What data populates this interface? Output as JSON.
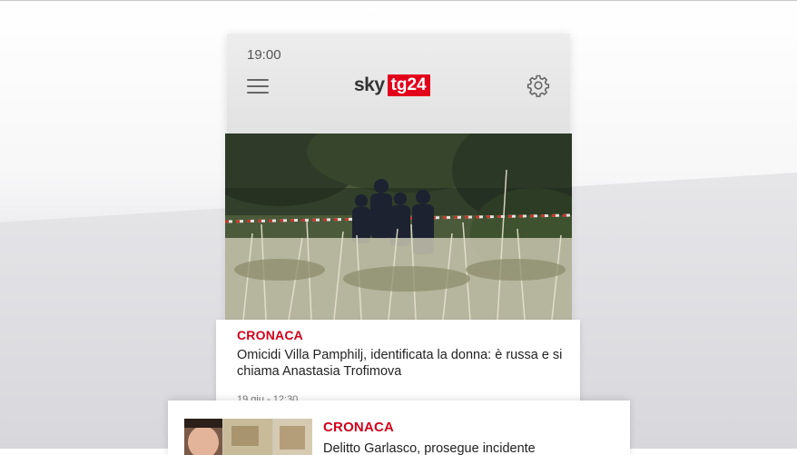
{
  "status_bar": {
    "time": "19:00"
  },
  "header": {
    "logo_sky": "sky",
    "logo_tg": "tg24",
    "brand_color": "#e2001a",
    "menu_icon": "hamburger-menu-icon",
    "settings_icon": "gear-icon"
  },
  "articles": [
    {
      "category": "CRONACA",
      "headline": "Omicidi Villa Pamphilj, identificata la donna: è russa e si chiama Anastasia Trofimova",
      "date": "19 giu - 12:30"
    },
    {
      "category": "CRONACA",
      "headline": "Delitto Garlasco, prosegue incidente"
    }
  ],
  "category_color": "#d0021b"
}
